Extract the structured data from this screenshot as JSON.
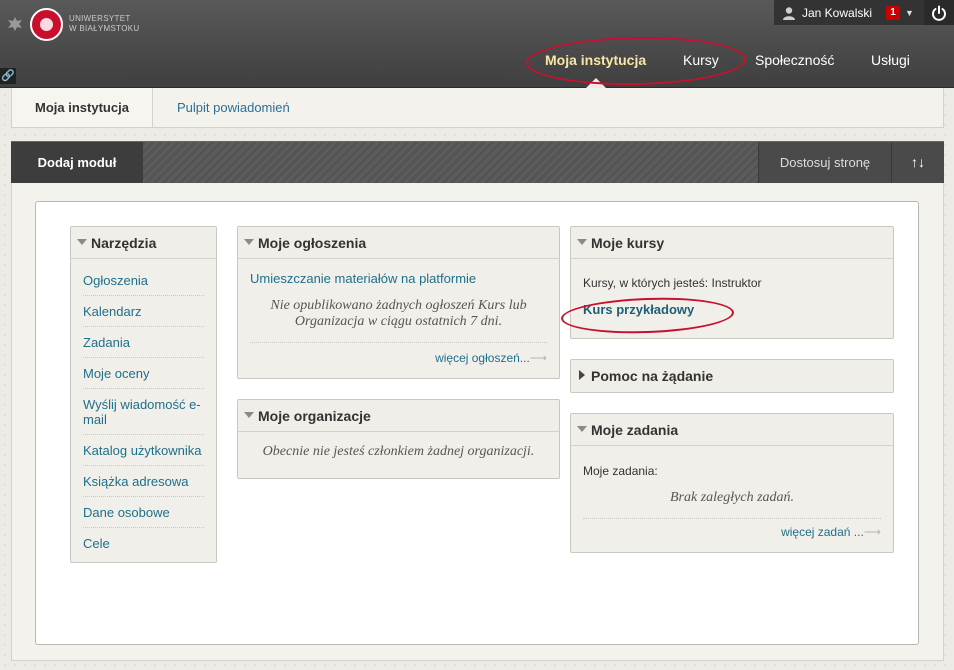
{
  "header": {
    "logo_lines": [
      "UNIWERSYTET",
      "W BIAŁYMSTOKU"
    ],
    "user_name": "Jan Kowalski",
    "notification_count": "1",
    "nav_tabs": [
      {
        "label": "Moja instytucja",
        "active": true
      },
      {
        "label": "Kursy"
      },
      {
        "label": "Społeczność"
      },
      {
        "label": "Usługi"
      }
    ]
  },
  "subtabs": [
    "Moja instytucja",
    "Pulpit powiadomień"
  ],
  "module_bar": {
    "add_label": "Dodaj moduł",
    "customize_label": "Dostosuj stronę",
    "reorder_icon": "sort-arrows-icon"
  },
  "modules": {
    "tools": {
      "title": "Narzędzia",
      "items": [
        "Ogłoszenia",
        "Kalendarz",
        "Zadania",
        "Moje oceny",
        "Wyślij wiadomość e-mail",
        "Katalog użytkownika",
        "Książka adresowa",
        "Dane osobowe",
        "Cele"
      ]
    },
    "announcements": {
      "title": "Moje ogłoszenia",
      "link": "Umieszczanie materiałów na platformie",
      "note": "Nie opublikowano żadnych ogłoszeń Kurs lub Organizacja w ciągu ostatnich 7 dni.",
      "more": "więcej ogłoszeń..."
    },
    "organizations": {
      "title": "Moje organizacje",
      "note": "Obecnie nie jesteś członkiem żadnej organizacji."
    },
    "courses": {
      "title": "Moje kursy",
      "role_text": "Kursy, w których jesteś: Instruktor",
      "course_link": "Kurs przykładowy"
    },
    "help": {
      "title": "Pomoc na żądanie"
    },
    "tasks": {
      "title": "Moje zadania",
      "label": "Moje zadania:",
      "note": "Brak zaległych zadań.",
      "more": "więcej zadań ..."
    }
  },
  "colors": {
    "accent_link": "#1f6f8b",
    "annotation": "#c8102e",
    "active_nav": "#f6e7a8"
  }
}
